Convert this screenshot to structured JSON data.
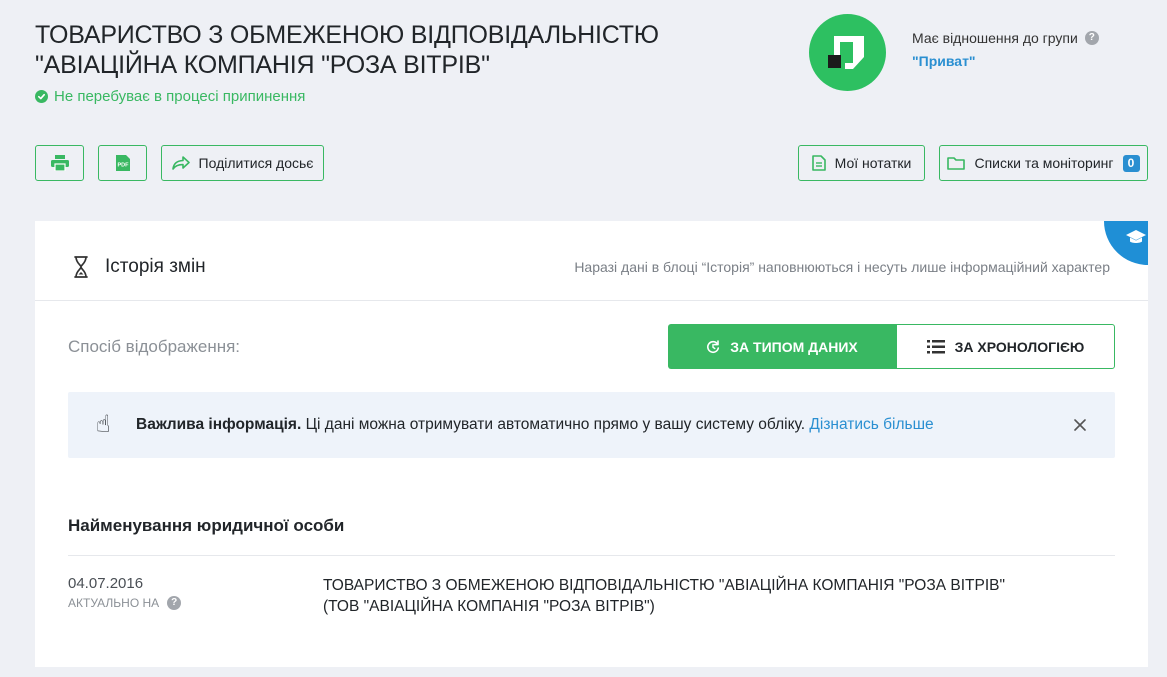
{
  "company": {
    "title_line1": "ТОВАРИСТВО З ОБМЕЖЕНОЮ ВІДПОВІДАЛЬНІСТЮ",
    "title_line2": "\"АВІАЦІЙНА КОМПАНІЯ \"РОЗА ВІТРІВ\"",
    "status": "Не перебуває в процесі припинення",
    "status_color": "#39b862"
  },
  "group": {
    "label": "Має відношення до групи",
    "name": "\"Приват\"",
    "logo_color": "#2dc061"
  },
  "toolbar": {
    "print_icon": "printer-icon",
    "pdf_icon": "pdf-icon",
    "pdf_text": "PDF",
    "share_label": "Поділитися досьє",
    "notes_label": "Мої нотатки",
    "lists_label": "Списки та моніторинг",
    "lists_count": "0"
  },
  "history": {
    "title": "Історія змін",
    "note": "Наразі дані в блоці “Історія” наповнюються і несуть лише інформаційний характер",
    "display_label": "Спосіб відображення:",
    "view_by_type": "ЗА ТИПОМ ДАНИХ",
    "view_by_chronology": "ЗА ХРОНОЛОГІЄЮ",
    "info_bold": "Важлива інформація.",
    "info_text": " Ці дані можна отримувати автоматично прямо у вашу систему обліку. ",
    "info_link": "Дізнатись більше",
    "section_title": "Найменування юридичної особи",
    "entries": [
      {
        "date": "04.07.2016",
        "actual_label": "АКТУАЛЬНО НА",
        "value_line1": "ТОВАРИСТВО З ОБМЕЖЕНОЮ ВІДПОВІДАЛЬНІСТЮ \"АВІАЦІЙНА КОМПАНІЯ \"РОЗА ВІТРІВ\"",
        "value_line2": "(ТОВ \"АВІАЦІЙНА КОМПАНІЯ \"РОЗА ВІТРІВ\")"
      }
    ]
  },
  "colors": {
    "accent_green": "#39b862",
    "link_blue": "#2a8fd1",
    "background": "#eef0f5"
  }
}
